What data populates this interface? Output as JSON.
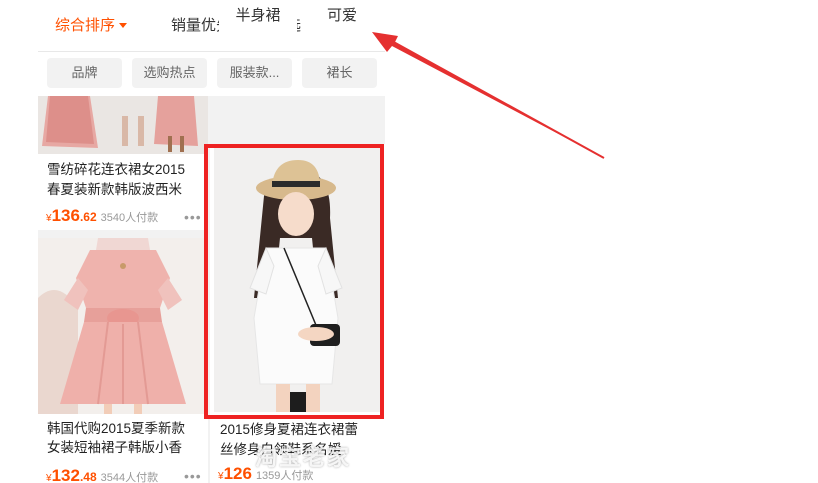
{
  "sortbar": {
    "comprehensive": "综合排序",
    "sales": "销量优先",
    "filter": "筛选"
  },
  "tags": [
    "品牌",
    "选购热点",
    "服装款...",
    "裙长"
  ],
  "recommend_chips": [
    "半身裙",
    "可爱"
  ],
  "products": [
    {
      "title_line1": "雪纺碎花连衣裙女2015",
      "title_line2": "春夏装新款韩版波西米",
      "currency": "¥",
      "price_int": "136",
      "price_dec": ".62",
      "sold": "3540人付款"
    },
    {
      "title_line1": "韩国代购2015夏季新款",
      "title_line2": "女装短袖裙子韩版小香",
      "currency": "¥",
      "price_int": "132",
      "price_dec": ".48",
      "sold": "3544人付款"
    },
    {
      "title_line1": "2015修身夏裙连衣裙蕾",
      "title_line2": "丝修身白领鞋系名媛",
      "currency": "¥",
      "price_int": "126",
      "price_dec": "",
      "sold": "1359人付款"
    }
  ],
  "more_glyph": "•••",
  "watermark": "淘宝老家",
  "colors": {
    "accent": "#ff5000",
    "highlight": "#ee2222"
  }
}
